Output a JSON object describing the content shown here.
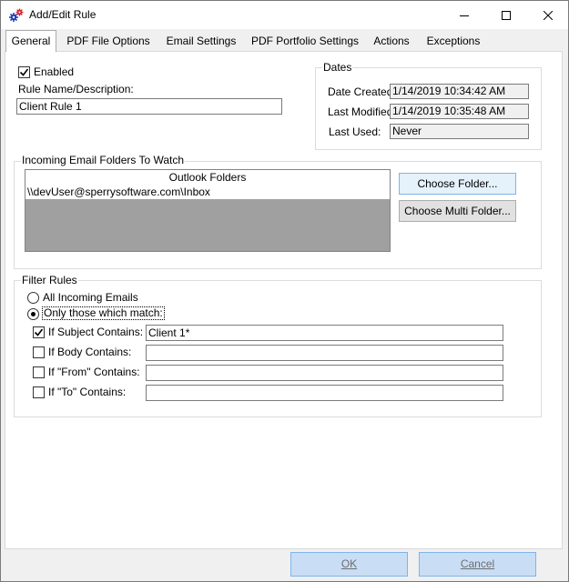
{
  "window": {
    "title": "Add/Edit Rule"
  },
  "tabs": [
    {
      "label": "General",
      "active": true
    },
    {
      "label": "PDF File Options",
      "active": false
    },
    {
      "label": "Email Settings",
      "active": false
    },
    {
      "label": "PDF Portfolio Settings",
      "active": false
    },
    {
      "label": "Actions",
      "active": false
    },
    {
      "label": "Exceptions",
      "active": false
    }
  ],
  "general": {
    "enabled_label": "Enabled",
    "enabled_checked": true,
    "rule_name_label": "Rule Name/Description:",
    "rule_name_value": "Client Rule 1"
  },
  "dates": {
    "title": "Dates",
    "created_label": "Date Created:",
    "created_value": "1/14/2019 10:34:42 AM",
    "modified_label": "Last Modified:",
    "modified_value": "1/14/2019 10:35:48 AM",
    "used_label": "Last Used:",
    "used_value": "Never"
  },
  "folders": {
    "title": "Incoming Email Folders To Watch",
    "column_header": "Outlook Folders",
    "items": [
      "\\\\devUser@sperrysoftware.com\\Inbox"
    ],
    "choose_folder_label": "Choose Folder...",
    "choose_multi_label": "Choose Multi Folder..."
  },
  "filter": {
    "title": "Filter Rules",
    "all_label": "All Incoming Emails",
    "only_label": "Only those which match:",
    "selected": "only",
    "conditions": [
      {
        "label": "If Subject Contains:",
        "checked": true,
        "value": "Client 1*"
      },
      {
        "label": "If Body Contains:",
        "checked": false,
        "value": ""
      },
      {
        "label": "If \"From\" Contains:",
        "checked": false,
        "value": ""
      },
      {
        "label": "If \"To\" Contains:",
        "checked": false,
        "value": ""
      }
    ]
  },
  "footer": {
    "ok_label": "OK",
    "cancel_label": "Cancel"
  },
  "colors": {
    "window_bg": "#f0f0f0",
    "panel_bg": "#ffffff",
    "accent_border": "#7eb4ea",
    "list_empty_bg": "#a0a0a0"
  }
}
